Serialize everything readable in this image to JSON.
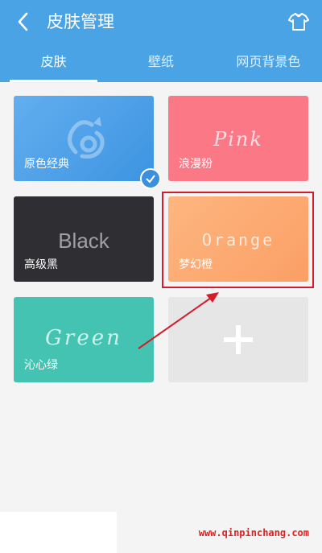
{
  "header": {
    "title": "皮肤管理",
    "back_icon": "chevron-left-icon",
    "shirt_icon": "tshirt-icon"
  },
  "tabs": [
    {
      "label": "皮肤",
      "active": true
    },
    {
      "label": "壁纸",
      "active": false
    },
    {
      "label": "网页背景色",
      "active": false
    }
  ],
  "skins": [
    {
      "label": "原色经典",
      "script": "",
      "color": "#4a9ee6",
      "selected": true
    },
    {
      "label": "浪漫粉",
      "script": "Pink",
      "color": "#fb7886",
      "selected": false
    },
    {
      "label": "高级黑",
      "script": "Black",
      "color": "#2e2e33",
      "selected": false
    },
    {
      "label": "梦幻橙",
      "script": "Orange",
      "color": "#fcaa72",
      "selected": false
    },
    {
      "label": "沁心绿",
      "script": "Green",
      "color": "#44c3b2",
      "selected": false
    }
  ],
  "add_skin": {
    "icon": "plus-icon"
  },
  "annotation": {
    "highlight_color": "#d41d2a"
  },
  "watermark": "www.qinpinchang.com"
}
